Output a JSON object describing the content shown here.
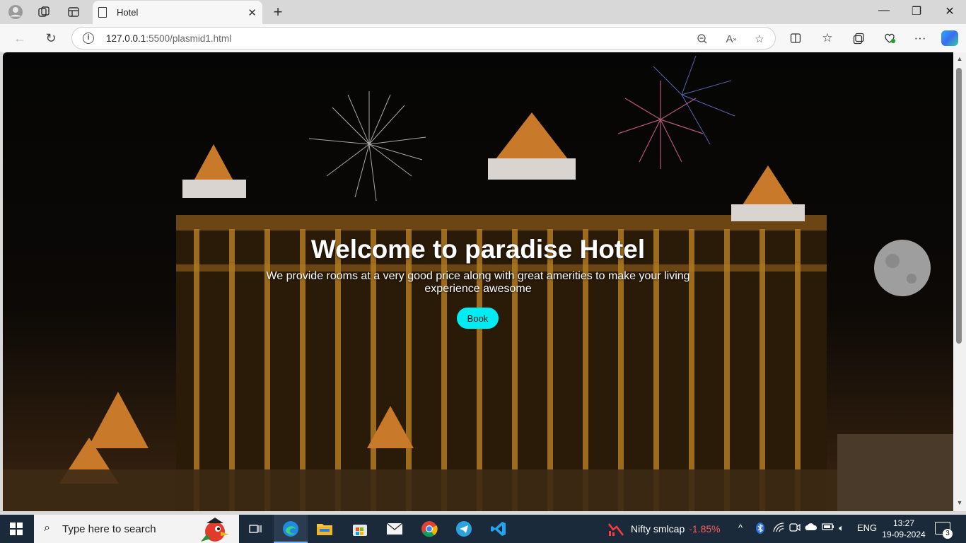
{
  "browser": {
    "tab_title": "Hotel",
    "url_host": "127.0.0.1",
    "url_rest": ":5500/plasmid1.html"
  },
  "hero": {
    "title": "Welcome to paradise Hotel",
    "subtitle": "We provide rooms at a very good price along with great amerities to make your living experience awesome",
    "book_label": "Book",
    "accent_color": "#00ecf3"
  },
  "taskbar": {
    "search_placeholder": "Type here to search",
    "ticker_name": "Nifty smlcap",
    "ticker_change": "-1.85%",
    "language": "ENG",
    "time": "13:27",
    "date": "19-09-2024",
    "notification_count": "3"
  }
}
